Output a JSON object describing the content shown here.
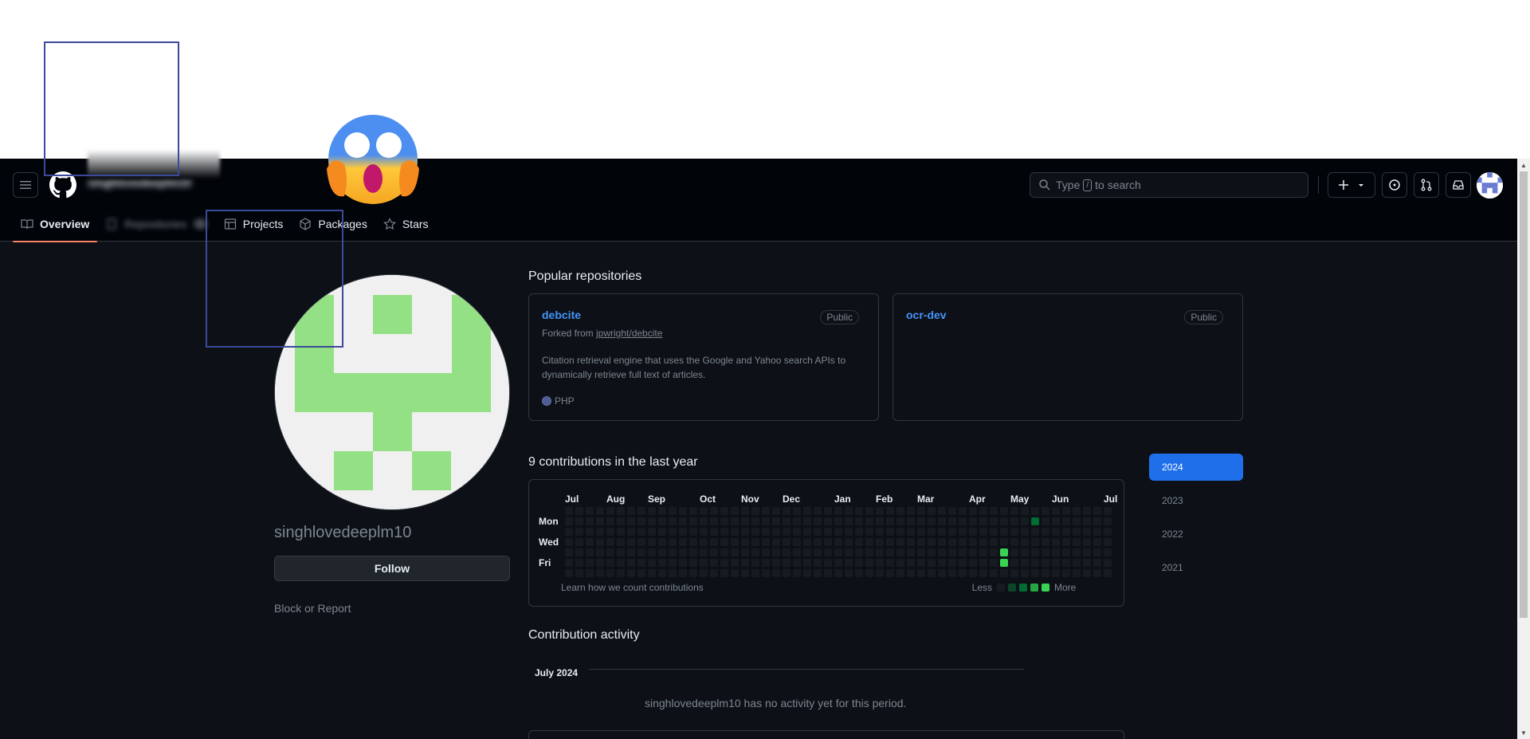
{
  "header": {
    "username": "singhlovedeeplm10",
    "search_placeholder_prefix": "Type",
    "search_key": "/",
    "search_placeholder_suffix": "to search"
  },
  "tabs": [
    {
      "label": "Overview",
      "icon": "book-icon",
      "active": true
    },
    {
      "label": "Repositories",
      "icon": "repo-icon",
      "count": "6",
      "blurred": true
    },
    {
      "label": "Projects",
      "icon": "table-icon"
    },
    {
      "label": "Packages",
      "icon": "package-icon"
    },
    {
      "label": "Stars",
      "icon": "star-icon"
    }
  ],
  "profile": {
    "name": "singhlovedeeplm10",
    "follow_label": "Follow",
    "block_label": "Block or Report",
    "identicon_color": "#94e084"
  },
  "popular": {
    "title": "Popular repositories",
    "repos": [
      {
        "name": "debcite",
        "badge": "Public",
        "forked_prefix": "Forked from ",
        "forked_from": "jpwright/debcite",
        "description": "Citation retrieval engine that uses the Google and Yahoo search APIs to dynamically retrieve full text of articles.",
        "language": "PHP",
        "language_color": "#4F5D95"
      },
      {
        "name": "ocr-dev",
        "badge": "Public"
      }
    ]
  },
  "contributions": {
    "title": "9 contributions in the last year",
    "months": [
      "Jul",
      "Aug",
      "Sep",
      "Oct",
      "Nov",
      "Dec",
      "Jan",
      "Feb",
      "Mar",
      "Apr",
      "May",
      "Jun",
      "Jul"
    ],
    "days": [
      "Mon",
      "Wed",
      "Fri"
    ],
    "learn_link": "Learn how we count contributions",
    "less_label": "Less",
    "more_label": "More",
    "active_cells": [
      {
        "week": 45,
        "day": 1,
        "level": 2
      },
      {
        "week": 42,
        "day": 4,
        "level": 4
      },
      {
        "week": 42,
        "day": 5,
        "level": 4
      }
    ],
    "level_colors": [
      "#161b22",
      "#0e4429",
      "#006d32",
      "#26a641",
      "#39d353"
    ]
  },
  "years": [
    "2024",
    "2023",
    "2022",
    "2021"
  ],
  "activity": {
    "title": "Contribution activity",
    "month": "July 2024",
    "empty_text": "singhlovedeeplm10 has no activity yet for this period."
  }
}
